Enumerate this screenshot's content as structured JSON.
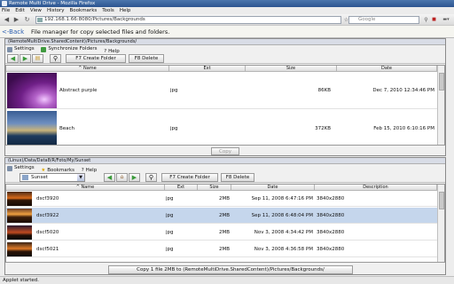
{
  "window": {
    "title": "Remote Multi Drive - Mozilla Firefox"
  },
  "menu": [
    "File",
    "Edit",
    "View",
    "History",
    "Bookmarks",
    "Tools",
    "Help"
  ],
  "nav": {
    "url": "192.168.1.66:8080/Pictures/Backgrounds",
    "search_placeholder": "Google"
  },
  "app": {
    "back_label": "<-Back",
    "description": "File manager for copy selected files and folders."
  },
  "remote": {
    "path": "(RemoteMultiDrive.SharedContent)/Pictures/Backgrounds/",
    "menu": {
      "settings": "Settings",
      "sync": "Synchronize Folders",
      "help": "Help"
    },
    "create_folder": "F7 Create Folder",
    "delete": "F8 Delete",
    "columns": {
      "name": "Name",
      "ext": "Ext",
      "size": "Size",
      "date": "Date"
    },
    "files": [
      {
        "name": "Abstract purple",
        "ext": "jpg",
        "size": "86KB",
        "date": "Dec 7, 2010 12:34:46 PM"
      },
      {
        "name": "Beach",
        "ext": "jpg",
        "size": "372KB",
        "date": "Feb 15, 2010 6:10:16 PM"
      }
    ],
    "copy_button": "Copy"
  },
  "local": {
    "path": "(Linux)/Data/Data8/R/Foto/My/Sunset",
    "menu": {
      "settings": "Settings",
      "bookmarks": "Bookmarks",
      "help": "Help"
    },
    "combo_value": "Sunset",
    "create_folder": "F7 Create Folder",
    "delete": "F8 Delete",
    "columns": {
      "name": "Name",
      "ext": "Ext",
      "size": "Size",
      "date": "Date",
      "desc": "Description"
    },
    "files": [
      {
        "name": "dscf3920",
        "ext": "jpg",
        "size": "2MB",
        "date": "Sep 11, 2008 6:47:16 PM",
        "desc": "3840x2880"
      },
      {
        "name": "dscf3922",
        "ext": "jpg",
        "size": "2MB",
        "date": "Sep 11, 2008 6:48:04 PM",
        "desc": "3840x2880"
      },
      {
        "name": "dscf5020",
        "ext": "jpg",
        "size": "2MB",
        "date": "Nov 3, 2008 4:34:42 PM",
        "desc": "3840x2880"
      },
      {
        "name": "dscf5021",
        "ext": "jpg",
        "size": "2MB",
        "date": "Nov 3, 2008 4:36:58 PM",
        "desc": "3840x2880"
      }
    ],
    "copy_button": "Copy 1 file 2MB to (RemoteMultiDrive.SharedContent)/Pictures/Backgrounds/"
  },
  "status": "Applet started.",
  "colors": {
    "titlebar": "#2c5590",
    "selection": "#c5d6ec",
    "path_bar": "#d8dce6"
  },
  "icons": [
    "settings-icon",
    "sync-icon",
    "help-icon",
    "bookmark-star-icon",
    "home-icon",
    "search-icon",
    "arrow-left-icon",
    "arrow-right-icon",
    "folder-icon",
    "refresh-icon"
  ]
}
